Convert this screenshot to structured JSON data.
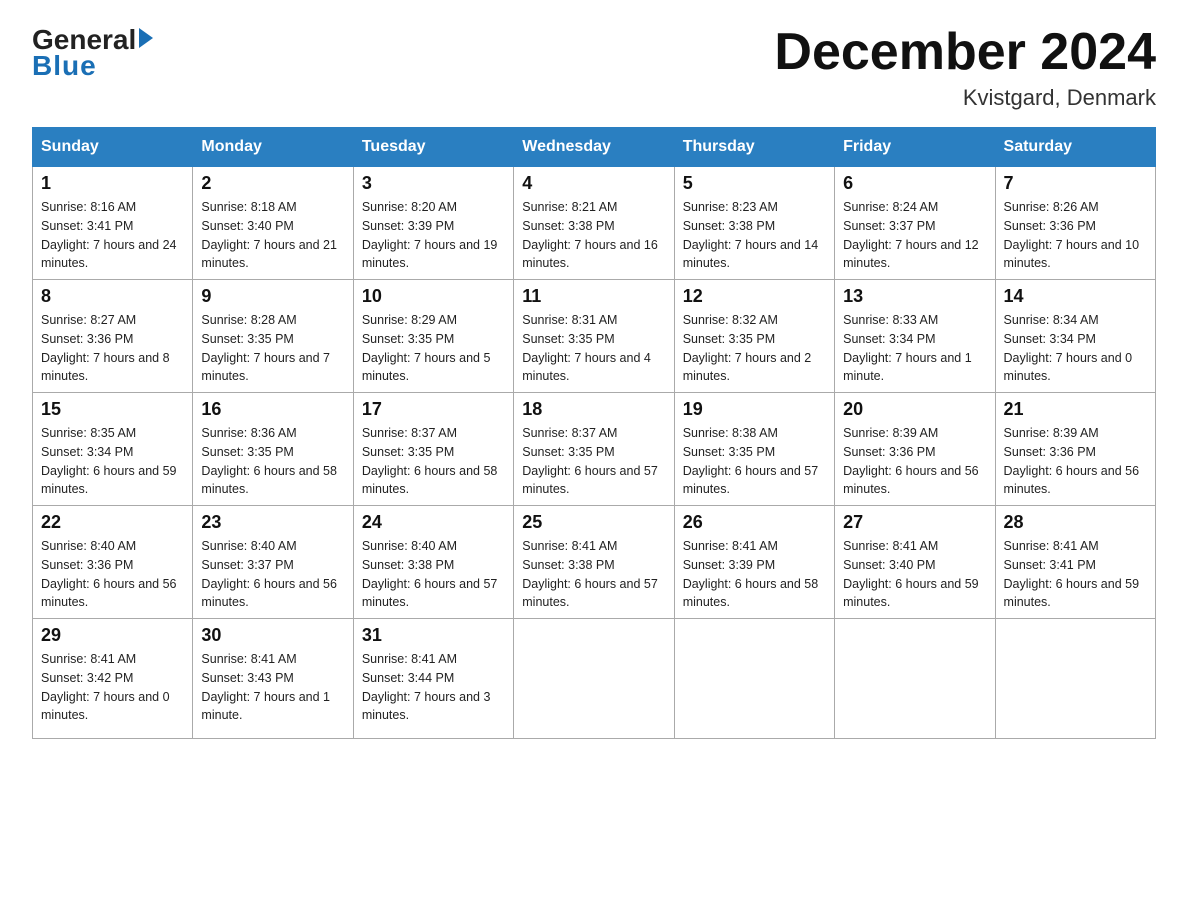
{
  "header": {
    "logo_general": "General",
    "logo_blue": "Blue",
    "month_title": "December 2024",
    "location": "Kvistgard, Denmark"
  },
  "days_of_week": [
    "Sunday",
    "Monday",
    "Tuesday",
    "Wednesday",
    "Thursday",
    "Friday",
    "Saturday"
  ],
  "weeks": [
    [
      {
        "day": "1",
        "sunrise": "8:16 AM",
        "sunset": "3:41 PM",
        "daylight": "7 hours and 24 minutes."
      },
      {
        "day": "2",
        "sunrise": "8:18 AM",
        "sunset": "3:40 PM",
        "daylight": "7 hours and 21 minutes."
      },
      {
        "day": "3",
        "sunrise": "8:20 AM",
        "sunset": "3:39 PM",
        "daylight": "7 hours and 19 minutes."
      },
      {
        "day": "4",
        "sunrise": "8:21 AM",
        "sunset": "3:38 PM",
        "daylight": "7 hours and 16 minutes."
      },
      {
        "day": "5",
        "sunrise": "8:23 AM",
        "sunset": "3:38 PM",
        "daylight": "7 hours and 14 minutes."
      },
      {
        "day": "6",
        "sunrise": "8:24 AM",
        "sunset": "3:37 PM",
        "daylight": "7 hours and 12 minutes."
      },
      {
        "day": "7",
        "sunrise": "8:26 AM",
        "sunset": "3:36 PM",
        "daylight": "7 hours and 10 minutes."
      }
    ],
    [
      {
        "day": "8",
        "sunrise": "8:27 AM",
        "sunset": "3:36 PM",
        "daylight": "7 hours and 8 minutes."
      },
      {
        "day": "9",
        "sunrise": "8:28 AM",
        "sunset": "3:35 PM",
        "daylight": "7 hours and 7 minutes."
      },
      {
        "day": "10",
        "sunrise": "8:29 AM",
        "sunset": "3:35 PM",
        "daylight": "7 hours and 5 minutes."
      },
      {
        "day": "11",
        "sunrise": "8:31 AM",
        "sunset": "3:35 PM",
        "daylight": "7 hours and 4 minutes."
      },
      {
        "day": "12",
        "sunrise": "8:32 AM",
        "sunset": "3:35 PM",
        "daylight": "7 hours and 2 minutes."
      },
      {
        "day": "13",
        "sunrise": "8:33 AM",
        "sunset": "3:34 PM",
        "daylight": "7 hours and 1 minute."
      },
      {
        "day": "14",
        "sunrise": "8:34 AM",
        "sunset": "3:34 PM",
        "daylight": "7 hours and 0 minutes."
      }
    ],
    [
      {
        "day": "15",
        "sunrise": "8:35 AM",
        "sunset": "3:34 PM",
        "daylight": "6 hours and 59 minutes."
      },
      {
        "day": "16",
        "sunrise": "8:36 AM",
        "sunset": "3:35 PM",
        "daylight": "6 hours and 58 minutes."
      },
      {
        "day": "17",
        "sunrise": "8:37 AM",
        "sunset": "3:35 PM",
        "daylight": "6 hours and 58 minutes."
      },
      {
        "day": "18",
        "sunrise": "8:37 AM",
        "sunset": "3:35 PM",
        "daylight": "6 hours and 57 minutes."
      },
      {
        "day": "19",
        "sunrise": "8:38 AM",
        "sunset": "3:35 PM",
        "daylight": "6 hours and 57 minutes."
      },
      {
        "day": "20",
        "sunrise": "8:39 AM",
        "sunset": "3:36 PM",
        "daylight": "6 hours and 56 minutes."
      },
      {
        "day": "21",
        "sunrise": "8:39 AM",
        "sunset": "3:36 PM",
        "daylight": "6 hours and 56 minutes."
      }
    ],
    [
      {
        "day": "22",
        "sunrise": "8:40 AM",
        "sunset": "3:36 PM",
        "daylight": "6 hours and 56 minutes."
      },
      {
        "day": "23",
        "sunrise": "8:40 AM",
        "sunset": "3:37 PM",
        "daylight": "6 hours and 56 minutes."
      },
      {
        "day": "24",
        "sunrise": "8:40 AM",
        "sunset": "3:38 PM",
        "daylight": "6 hours and 57 minutes."
      },
      {
        "day": "25",
        "sunrise": "8:41 AM",
        "sunset": "3:38 PM",
        "daylight": "6 hours and 57 minutes."
      },
      {
        "day": "26",
        "sunrise": "8:41 AM",
        "sunset": "3:39 PM",
        "daylight": "6 hours and 58 minutes."
      },
      {
        "day": "27",
        "sunrise": "8:41 AM",
        "sunset": "3:40 PM",
        "daylight": "6 hours and 59 minutes."
      },
      {
        "day": "28",
        "sunrise": "8:41 AM",
        "sunset": "3:41 PM",
        "daylight": "6 hours and 59 minutes."
      }
    ],
    [
      {
        "day": "29",
        "sunrise": "8:41 AM",
        "sunset": "3:42 PM",
        "daylight": "7 hours and 0 minutes."
      },
      {
        "day": "30",
        "sunrise": "8:41 AM",
        "sunset": "3:43 PM",
        "daylight": "7 hours and 1 minute."
      },
      {
        "day": "31",
        "sunrise": "8:41 AM",
        "sunset": "3:44 PM",
        "daylight": "7 hours and 3 minutes."
      },
      null,
      null,
      null,
      null
    ]
  ]
}
